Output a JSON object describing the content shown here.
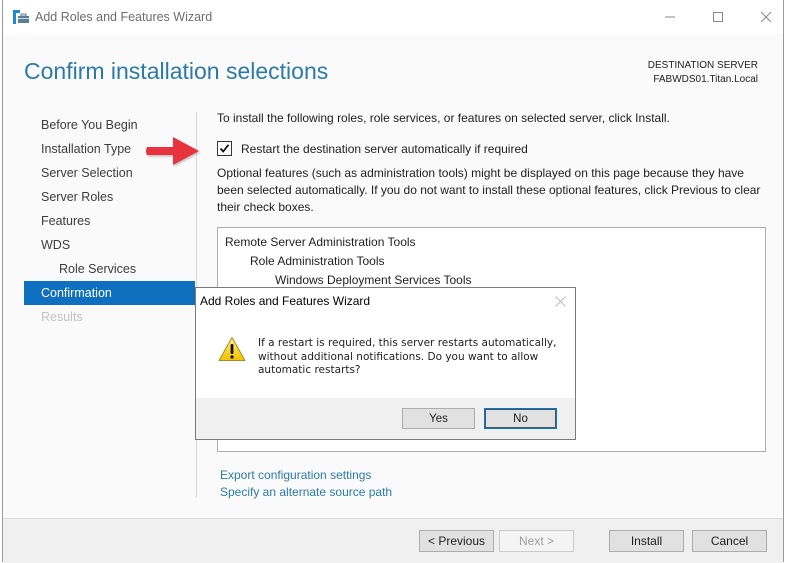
{
  "window": {
    "title": "Add Roles and Features Wizard",
    "app_icon": "server-manager-wizard-icon",
    "controls": {
      "minimize": "minimize-icon",
      "maximize": "maximize-icon",
      "close": "close-icon"
    }
  },
  "header": {
    "page_title": "Confirm installation selections",
    "destination_label": "DESTINATION SERVER",
    "destination_server": "FABWDS01.Titan.Local"
  },
  "nav": {
    "items": [
      {
        "label": "Before You Begin",
        "state": "normal"
      },
      {
        "label": "Installation Type",
        "state": "normal"
      },
      {
        "label": "Server Selection",
        "state": "normal"
      },
      {
        "label": "Server Roles",
        "state": "normal"
      },
      {
        "label": "Features",
        "state": "normal"
      },
      {
        "label": "WDS",
        "state": "normal"
      },
      {
        "label": "Role Services",
        "state": "sub"
      },
      {
        "label": "Confirmation",
        "state": "active"
      },
      {
        "label": "Results",
        "state": "disabled"
      }
    ]
  },
  "content": {
    "intro": "To install the following roles, role services, or features on selected server, click Install.",
    "restart_checkbox": {
      "label": "Restart the destination server automatically if required",
      "checked": true
    },
    "optional_note": "Optional features (such as administration tools) might be displayed on this page because they have been selected automatically. If you do not want to install these optional features, click Previous to clear their check boxes.",
    "selections": [
      {
        "label": "Remote Server Administration Tools",
        "level": 0
      },
      {
        "label": "Role Administration Tools",
        "level": 1
      },
      {
        "label": "Windows Deployment Services Tools",
        "level": 2
      }
    ],
    "links": {
      "export": "Export configuration settings",
      "alternate_source": "Specify an alternate source path"
    }
  },
  "footer": {
    "previous": "< Previous",
    "next": "Next >",
    "install": "Install",
    "cancel": "Cancel"
  },
  "dialog": {
    "title": "Add Roles and Features Wizard",
    "icon": "warning-icon",
    "message": "If a restart is required, this server restarts automatically, without additional notifications. Do you want to allow automatic restarts?",
    "yes": "Yes",
    "no": "No"
  },
  "annotation": {
    "type": "red-arrow",
    "color": "#e8323c"
  },
  "colors": {
    "accent": "#0e70bf",
    "title": "#2b7aa8",
    "link": "#2b7aa8"
  }
}
